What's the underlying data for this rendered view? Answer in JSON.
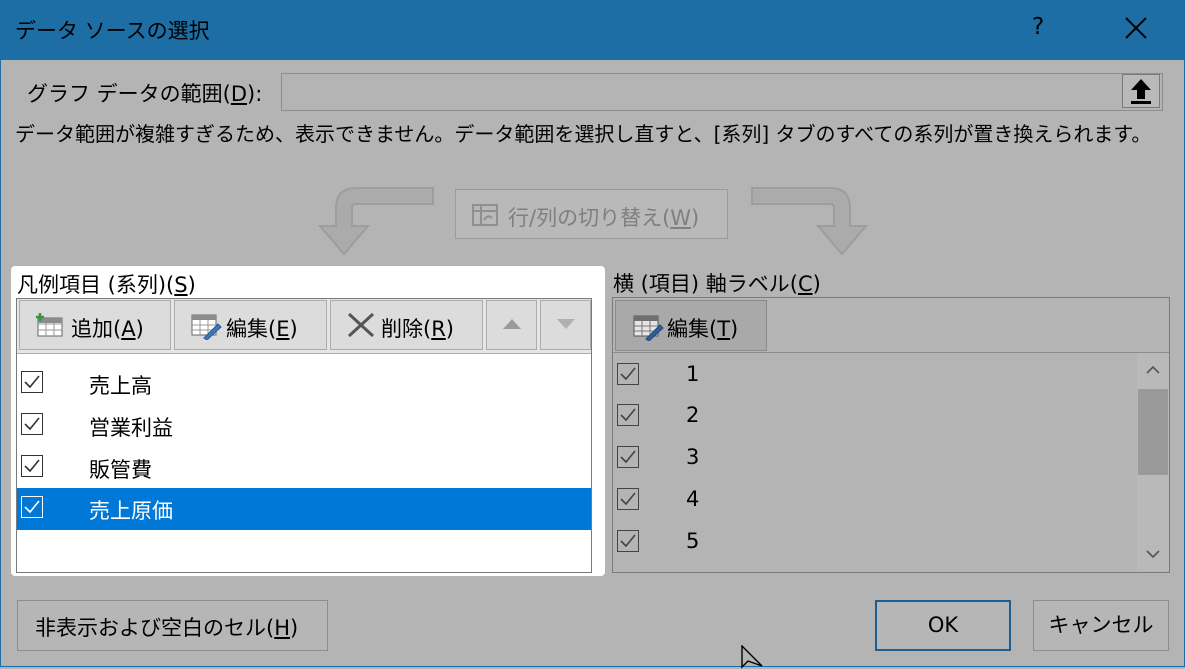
{
  "title": "データ ソースの選択",
  "help_label": "?",
  "range": {
    "label_prefix": "グラフ データの範囲(",
    "label_key": "D",
    "label_suffix": "):",
    "value": ""
  },
  "message": "データ範囲が複雑すぎるため、表示できません。データ範囲を選択し直すと、[系列] タブのすべての系列が置き換えられます。",
  "switch_button": {
    "prefix": "行/列の切り替え(",
    "key": "W",
    "suffix": ")"
  },
  "legend": {
    "title_prefix": "凡例項目 (系列)(",
    "title_key": "S",
    "title_suffix": ")",
    "add": {
      "prefix": "追加(",
      "key": "A",
      "suffix": ")"
    },
    "edit": {
      "prefix": "編集(",
      "key": "E",
      "suffix": ")"
    },
    "delete": {
      "prefix": "削除(",
      "key": "R",
      "suffix": ")"
    },
    "items": [
      {
        "label": "売上高",
        "checked": true
      },
      {
        "label": "営業利益",
        "checked": true
      },
      {
        "label": "販管費",
        "checked": true
      },
      {
        "label": "売上原価",
        "checked": true,
        "selected": true
      }
    ]
  },
  "axis": {
    "title_prefix": "横 (項目) 軸ラベル(",
    "title_key": "C",
    "title_suffix": ")",
    "edit": {
      "prefix": "編集(",
      "key": "T",
      "suffix": ")"
    },
    "items": [
      "1",
      "2",
      "3",
      "4",
      "5"
    ]
  },
  "footer": {
    "hidden_cells": {
      "prefix": "非表示および空白のセル(",
      "key": "H",
      "suffix": ")"
    },
    "ok": "OK",
    "cancel": "キャンセル"
  },
  "colors": {
    "titlebar": "#1c6ea4",
    "selection": "#0078d7",
    "overlay": "#b4b4b4"
  }
}
